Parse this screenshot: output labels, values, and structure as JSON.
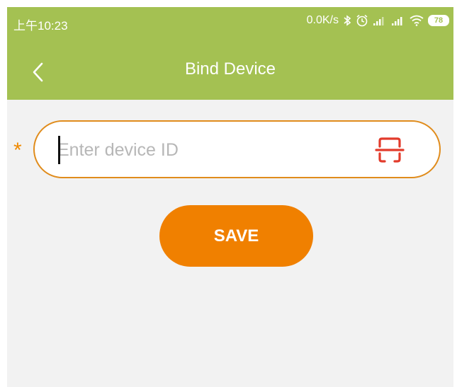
{
  "status_bar": {
    "time": "上午10:23",
    "net_speed": "0.0K/s",
    "battery": "78",
    "icons": [
      "bluetooth-icon",
      "alarm-icon",
      "signal-icon",
      "signal-icon",
      "wifi-icon",
      "battery-icon"
    ]
  },
  "header": {
    "title": "Bind Device",
    "back_icon": "chevron-left-icon",
    "background_color": "#a4c152"
  },
  "form": {
    "required_marker": "*",
    "device_id": {
      "value": "",
      "placeholder": "Enter device ID",
      "scan_icon": "scan-icon",
      "border_color": "#e08c1c"
    },
    "save_label": "SAVE",
    "save_color": "#f08000"
  }
}
